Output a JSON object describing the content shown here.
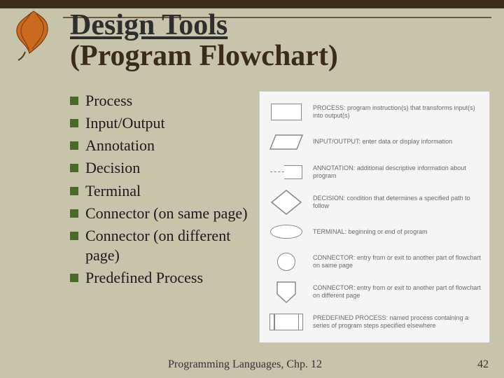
{
  "title": {
    "line1": "Design Tools",
    "line2": "(Program Flowchart)"
  },
  "bullets": [
    "Process",
    "Input/Output",
    "Annotation",
    "Decision",
    "Terminal",
    "Connector (on same page)",
    "Connector (on different page)",
    "Predefined Process"
  ],
  "legend": [
    {
      "label": "PROCESS:",
      "desc": "program instruction(s) that transforms input(s) into output(s)"
    },
    {
      "label": "INPUT/OUTPUT:",
      "desc": "enter data or display information"
    },
    {
      "label": "ANNOTATION:",
      "desc": "additional descriptive information about program"
    },
    {
      "label": "DECISION:",
      "desc": "condition that determines a specified path to follow"
    },
    {
      "label": "TERMINAL:",
      "desc": "beginning or end of program"
    },
    {
      "label": "CONNECTOR:",
      "desc": "entry from or exit to another part of flowchart on same page"
    },
    {
      "label": "CONNECTOR:",
      "desc": "entry from or exit to another part of flowchart on different page"
    },
    {
      "label": "PREDEFINED PROCESS:",
      "desc": "named process containing a series of program steps specified elsewhere"
    }
  ],
  "footer": "Programming Languages, Chp. 12",
  "page_number": "42"
}
